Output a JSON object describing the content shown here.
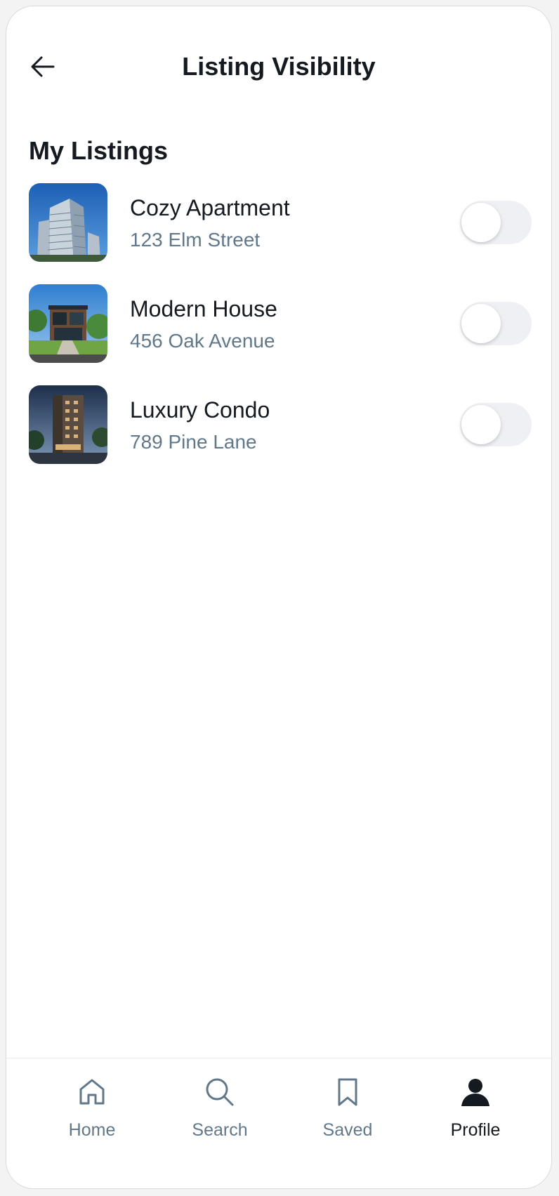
{
  "header": {
    "title": "Listing Visibility"
  },
  "section": {
    "title": "My Listings"
  },
  "listings": [
    {
      "name": "Cozy Apartment",
      "address": "123 Elm Street",
      "visible": false,
      "image": "apartment-tower-photo"
    },
    {
      "name": "Modern House",
      "address": "456 Oak Avenue",
      "visible": false,
      "image": "modern-house-photo"
    },
    {
      "name": "Luxury Condo",
      "address": "789 Pine Lane",
      "visible": false,
      "image": "condo-building-photo"
    }
  ],
  "nav": {
    "items": [
      {
        "label": "Home",
        "icon": "home-icon",
        "active": false
      },
      {
        "label": "Search",
        "icon": "search-icon",
        "active": false
      },
      {
        "label": "Saved",
        "icon": "bookmark-icon",
        "active": false
      },
      {
        "label": "Profile",
        "icon": "user-icon",
        "active": true
      }
    ]
  },
  "colors": {
    "text_primary": "#141a1f",
    "text_secondary": "#61788a",
    "toggle_track": "#eef0f3",
    "background": "#ffffff"
  }
}
